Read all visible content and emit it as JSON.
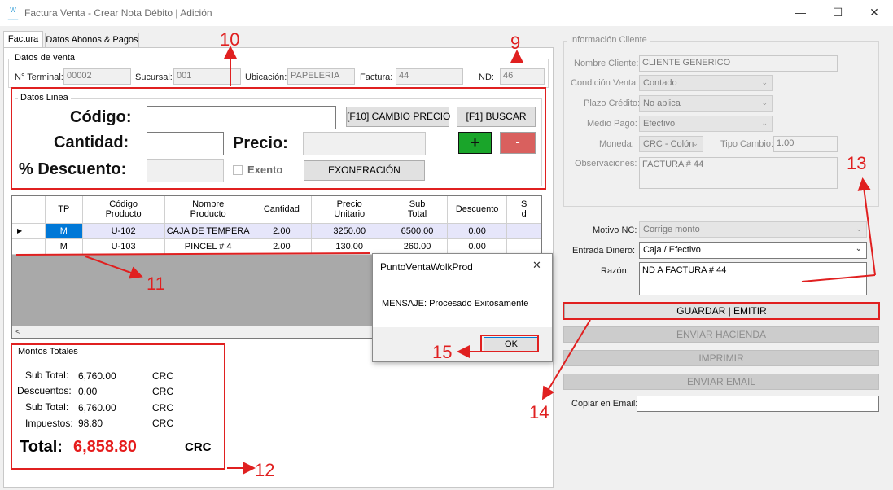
{
  "window": {
    "title": "Factura Venta - Crear Nota Débito | Adición",
    "minimize": "—",
    "maximize": "☐",
    "close": "✕"
  },
  "tabs": [
    "Factura",
    "Datos Abonos & Pagos"
  ],
  "datos_venta": {
    "title": "Datos de venta",
    "terminal_label": "N° Terminal:",
    "terminal_value": "00002",
    "sucursal_label": "Sucursal:",
    "sucursal_value": "001",
    "ubicacion_label": "Ubicación:",
    "ubicacion_value": "PAPELERIA",
    "factura_label": "Factura:",
    "factura_value": "44",
    "nd_label": "ND:",
    "nd_value": "46"
  },
  "datos_linea": {
    "title": "Datos Linea",
    "codigo_label": "Código:",
    "cantidad_label": "Cantidad:",
    "precio_label": "Precio:",
    "descuento_label": "% Descuento:",
    "exento_label": "Exento",
    "cambio_precio_btn": "[F10] CAMBIO PRECIO",
    "buscar_btn": "[F1] BUSCAR",
    "add_btn": "+",
    "remove_btn": "-",
    "exoneracion_btn": "EXONERACIÓN"
  },
  "grid": {
    "columns": [
      "TP",
      "Código\nProducto",
      "Nombre\nProducto",
      "Cantidad",
      "Precio\nUnitario",
      "Sub\nTotal",
      "Descuento",
      "S\nd"
    ],
    "rows": [
      {
        "tp": "M",
        "codigo": "U-102",
        "nombre": "CAJA DE TEMPERA",
        "cantidad": "2.00",
        "precio": "3250.00",
        "subtotal": "6500.00",
        "descuento": "0.00"
      },
      {
        "tp": "M",
        "codigo": "U-103",
        "nombre": "PINCEL # 4",
        "cantidad": "2.00",
        "precio": "130.00",
        "subtotal": "260.00",
        "descuento": "0.00"
      }
    ],
    "row_pointer": "▶",
    "scroll_left": "<"
  },
  "montos": {
    "title": "Montos Totales",
    "rows": [
      {
        "label": "Sub Total:",
        "value": "6,760.00",
        "currency": "CRC"
      },
      {
        "label": "Descuentos:",
        "value": "0.00",
        "currency": "CRC"
      },
      {
        "label": "Sub Total:",
        "value": "6,760.00",
        "currency": "CRC"
      },
      {
        "label": "Impuestos:",
        "value": "98.80",
        "currency": "CRC"
      }
    ],
    "total_label": "Total:",
    "total_value": "6,858.80",
    "total_currency": "CRC"
  },
  "dialog": {
    "title": "PuntoVentaWolkProd",
    "message": "MENSAJE: Procesado Exitosamente",
    "ok_button": "OK",
    "close": "✕"
  },
  "cliente": {
    "title": "Información Cliente",
    "nombre_label": "Nombre Cliente:",
    "nombre_value": "CLIENTE GENERICO",
    "condicion_label": "Condición Venta:",
    "condicion_value": "Contado",
    "plazo_label": "Plazo Crédito:",
    "plazo_value": "No aplica",
    "medio_label": "Medio Pago:",
    "medio_value": "Efectivo",
    "moneda_label": "Moneda:",
    "moneda_value": "CRC - Colón",
    "tipo_cambio_label": "Tipo Cambio:",
    "tipo_cambio_value": "1.00",
    "observaciones_label": "Observaciones:",
    "observaciones_value": "FACTURA # 44"
  },
  "nota": {
    "motivo_label": "Motivo NC:",
    "motivo_value": "Corrige monto",
    "entrada_label": "Entrada Dinero:",
    "entrada_value": "Caja / Efectivo",
    "razon_label": "Razón:",
    "razon_value": "ND A FACTURA  # 44",
    "copiar_label": "Copiar en Email:"
  },
  "actions": {
    "guardar": "GUARDAR | EMITIR",
    "enviar_hacienda": "ENVIAR HACIENDA",
    "imprimir": "IMPRIMIR",
    "enviar_email": "ENVIAR EMAIL"
  },
  "annotations": [
    "10",
    "9",
    "11",
    "12",
    "13",
    "14",
    "15"
  ],
  "colors": {
    "annotation_red": "#e02020",
    "add_green": "#1aa52a",
    "remove_red": "#d9605e",
    "total_red": "#e51c1c",
    "tp_blue": "#0078d7"
  }
}
